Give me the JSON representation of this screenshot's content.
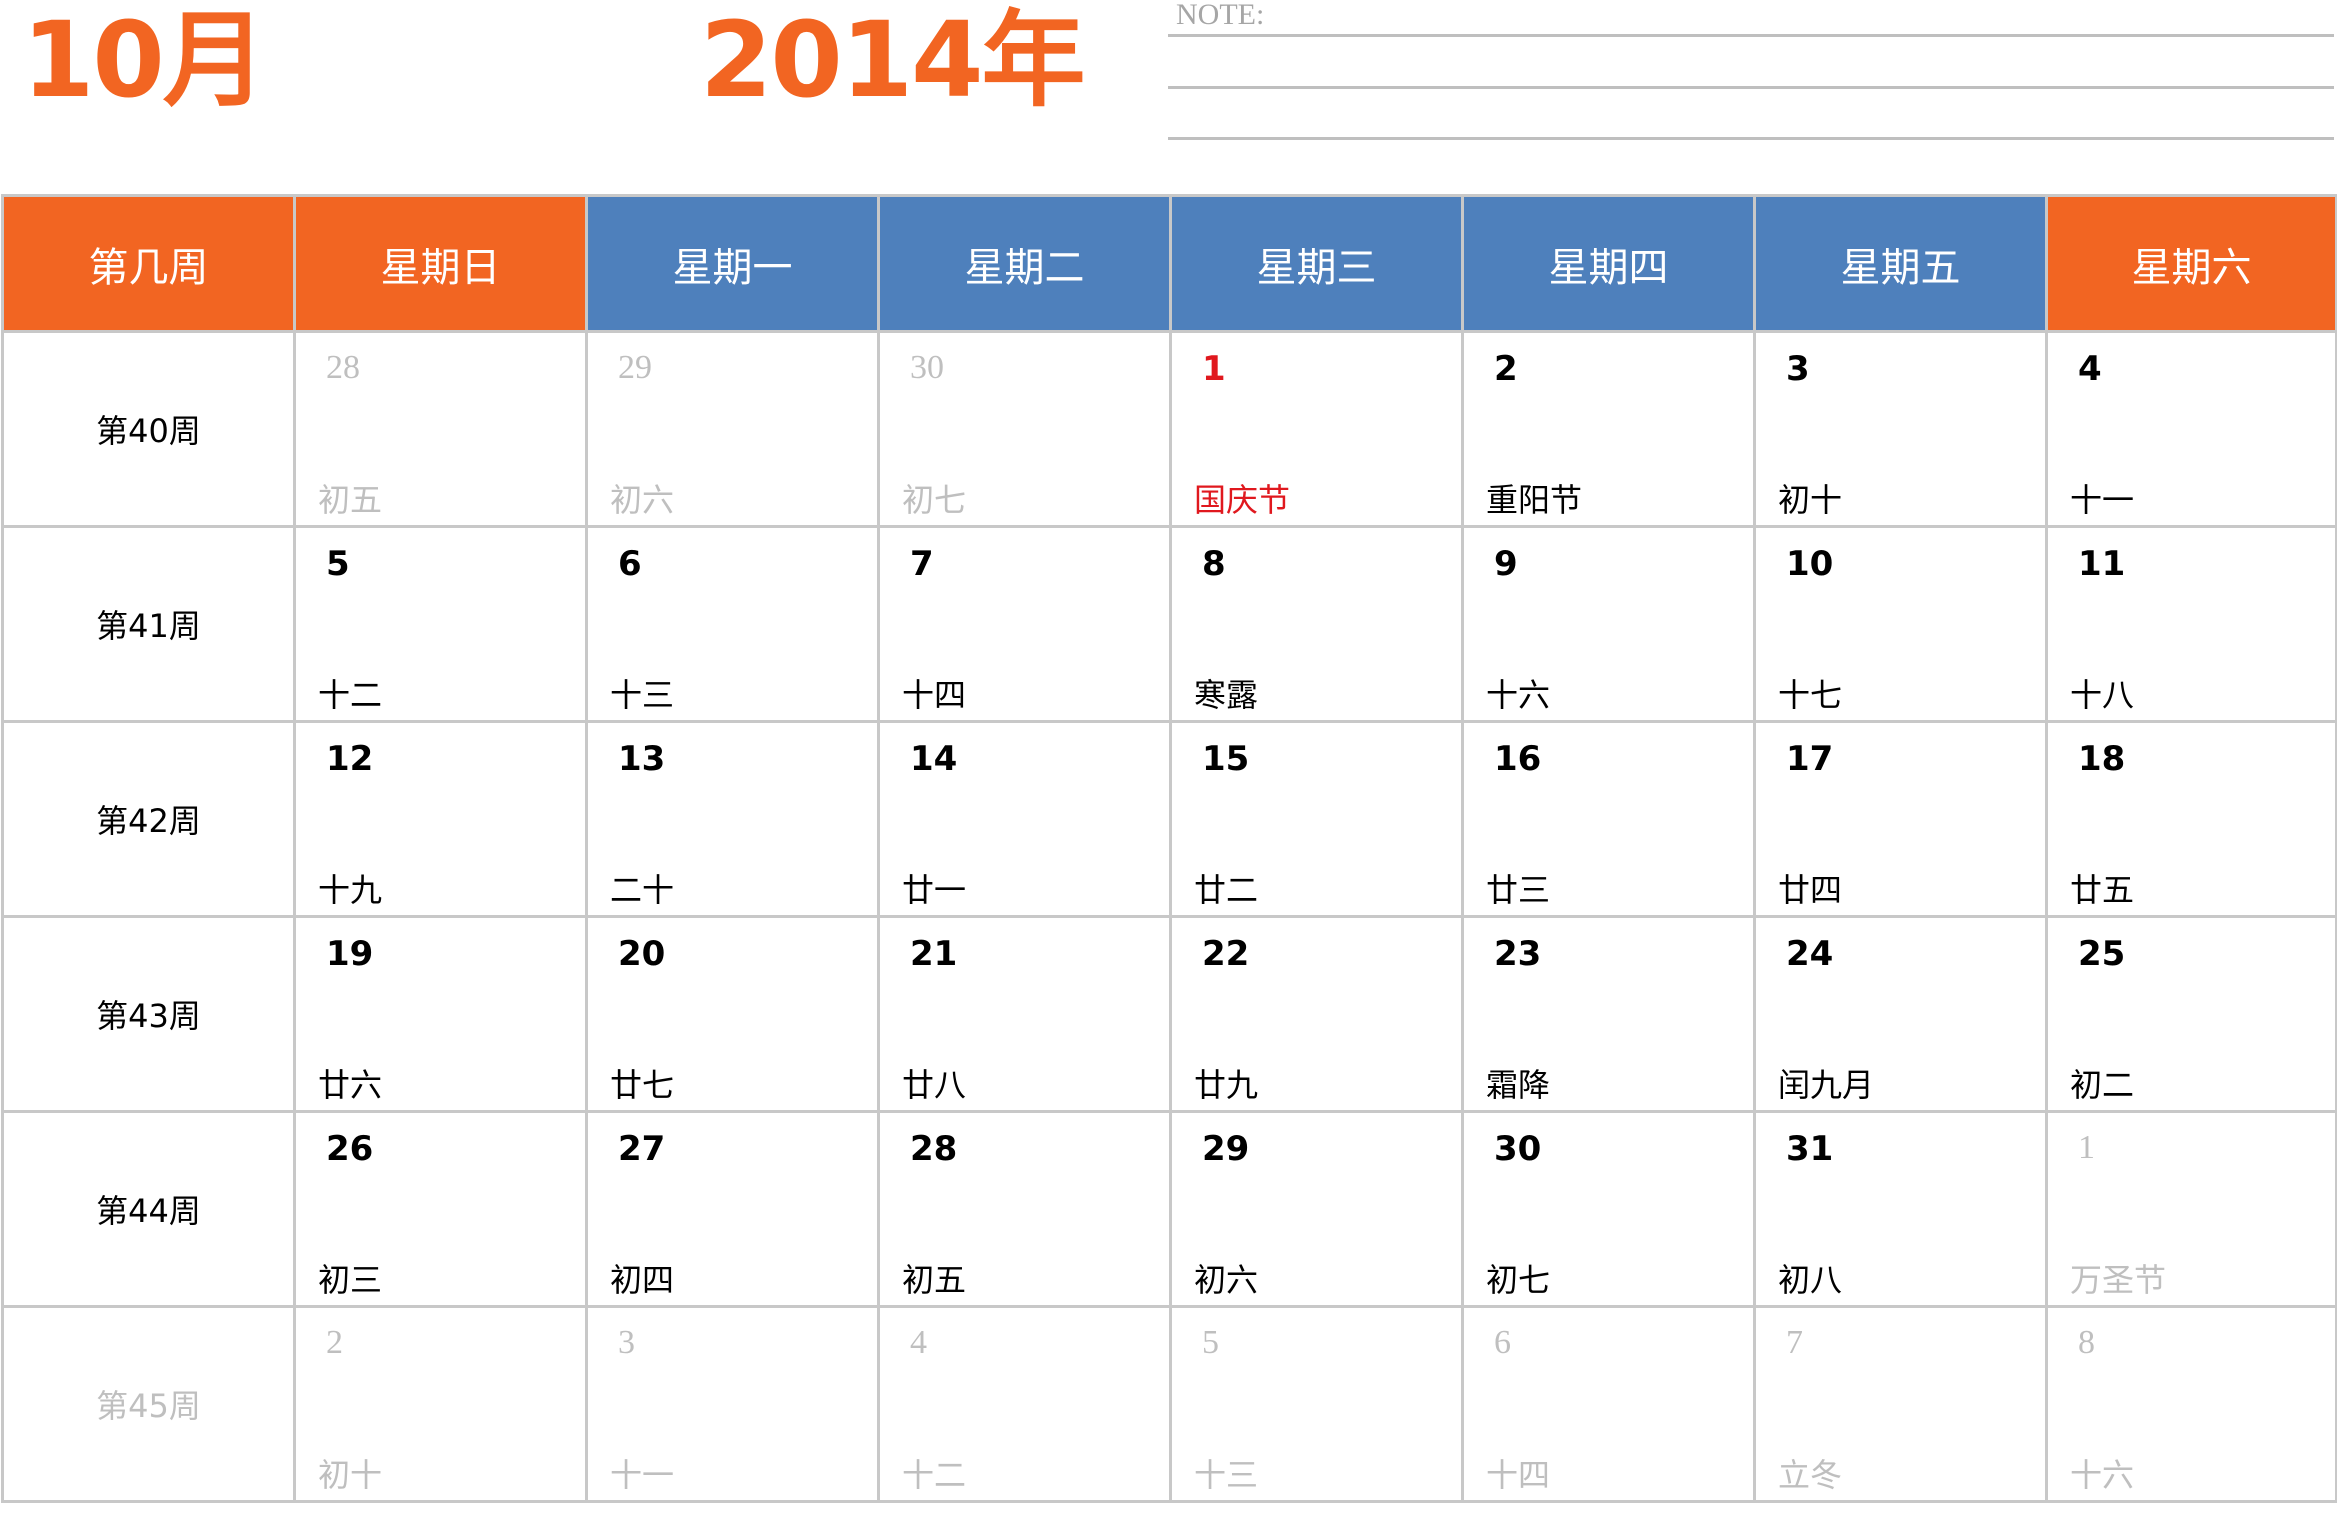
{
  "header": {
    "month": "10月",
    "year": "2014年",
    "note_label": "NOTE:"
  },
  "weekdays": [
    "第几周",
    "星期日",
    "星期一",
    "星期二",
    "星期三",
    "星期四",
    "星期五",
    "星期六"
  ],
  "colors": {
    "accent_orange": "#f26522",
    "accent_blue": "#4e80bc",
    "holiday_red": "#e0181e",
    "faded_gray": "#bfbfbf"
  },
  "weeks": [
    {
      "label": "第40周",
      "faded": false,
      "days": [
        {
          "day": "28",
          "lunar": "初五",
          "other": true,
          "holiday": false
        },
        {
          "day": "29",
          "lunar": "初六",
          "other": true,
          "holiday": false
        },
        {
          "day": "30",
          "lunar": "初七",
          "other": true,
          "holiday": false
        },
        {
          "day": "1",
          "lunar": "国庆节",
          "other": false,
          "holiday": true
        },
        {
          "day": "2",
          "lunar": "重阳节",
          "other": false,
          "holiday": false
        },
        {
          "day": "3",
          "lunar": "初十",
          "other": false,
          "holiday": false
        },
        {
          "day": "4",
          "lunar": "十一",
          "other": false,
          "holiday": false
        }
      ]
    },
    {
      "label": "第41周",
      "faded": false,
      "days": [
        {
          "day": "5",
          "lunar": "十二",
          "other": false,
          "holiday": false
        },
        {
          "day": "6",
          "lunar": "十三",
          "other": false,
          "holiday": false
        },
        {
          "day": "7",
          "lunar": "十四",
          "other": false,
          "holiday": false
        },
        {
          "day": "8",
          "lunar": "寒露",
          "other": false,
          "holiday": false
        },
        {
          "day": "9",
          "lunar": "十六",
          "other": false,
          "holiday": false
        },
        {
          "day": "10",
          "lunar": "十七",
          "other": false,
          "holiday": false
        },
        {
          "day": "11",
          "lunar": "十八",
          "other": false,
          "holiday": false
        }
      ]
    },
    {
      "label": "第42周",
      "faded": false,
      "days": [
        {
          "day": "12",
          "lunar": "十九",
          "other": false,
          "holiday": false
        },
        {
          "day": "13",
          "lunar": "二十",
          "other": false,
          "holiday": false
        },
        {
          "day": "14",
          "lunar": "廿一",
          "other": false,
          "holiday": false
        },
        {
          "day": "15",
          "lunar": "廿二",
          "other": false,
          "holiday": false
        },
        {
          "day": "16",
          "lunar": "廿三",
          "other": false,
          "holiday": false
        },
        {
          "day": "17",
          "lunar": "廿四",
          "other": false,
          "holiday": false
        },
        {
          "day": "18",
          "lunar": "廿五",
          "other": false,
          "holiday": false
        }
      ]
    },
    {
      "label": "第43周",
      "faded": false,
      "days": [
        {
          "day": "19",
          "lunar": "廿六",
          "other": false,
          "holiday": false
        },
        {
          "day": "20",
          "lunar": "廿七",
          "other": false,
          "holiday": false
        },
        {
          "day": "21",
          "lunar": "廿八",
          "other": false,
          "holiday": false
        },
        {
          "day": "22",
          "lunar": "廿九",
          "other": false,
          "holiday": false
        },
        {
          "day": "23",
          "lunar": "霜降",
          "other": false,
          "holiday": false
        },
        {
          "day": "24",
          "lunar": "闰九月",
          "other": false,
          "holiday": false
        },
        {
          "day": "25",
          "lunar": "初二",
          "other": false,
          "holiday": false
        }
      ]
    },
    {
      "label": "第44周",
      "faded": false,
      "days": [
        {
          "day": "26",
          "lunar": "初三",
          "other": false,
          "holiday": false
        },
        {
          "day": "27",
          "lunar": "初四",
          "other": false,
          "holiday": false
        },
        {
          "day": "28",
          "lunar": "初五",
          "other": false,
          "holiday": false
        },
        {
          "day": "29",
          "lunar": "初六",
          "other": false,
          "holiday": false
        },
        {
          "day": "30",
          "lunar": "初七",
          "other": false,
          "holiday": false
        },
        {
          "day": "31",
          "lunar": "初八",
          "other": false,
          "holiday": false
        },
        {
          "day": "1",
          "lunar": "万圣节",
          "other": true,
          "holiday": false
        }
      ]
    },
    {
      "label": "第45周",
      "faded": true,
      "days": [
        {
          "day": "2",
          "lunar": "初十",
          "other": true,
          "holiday": false
        },
        {
          "day": "3",
          "lunar": "十一",
          "other": true,
          "holiday": false
        },
        {
          "day": "4",
          "lunar": "十二",
          "other": true,
          "holiday": false
        },
        {
          "day": "5",
          "lunar": "十三",
          "other": true,
          "holiday": false
        },
        {
          "day": "6",
          "lunar": "十四",
          "other": true,
          "holiday": false
        },
        {
          "day": "7",
          "lunar": "立冬",
          "other": true,
          "holiday": false
        },
        {
          "day": "8",
          "lunar": "十六",
          "other": true,
          "holiday": false
        }
      ]
    }
  ]
}
